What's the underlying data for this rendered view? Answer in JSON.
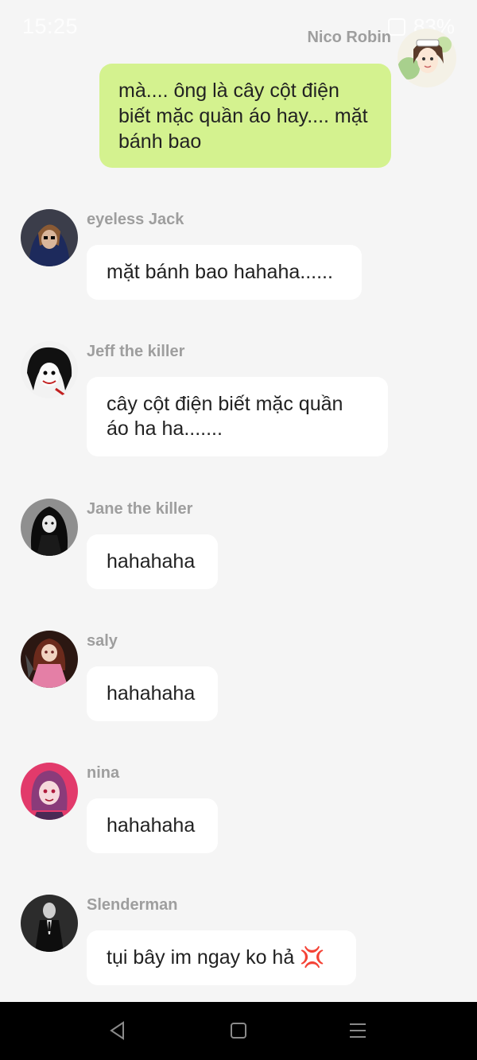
{
  "status_bar": {
    "time": "15:25",
    "battery": "83%"
  },
  "chat": {
    "self_message": {
      "sender": "Nico Robin",
      "avatar_icon": "anime-girl-avatar",
      "text": "mà.... ông là cây cột điện biết mặc quần áo hay.... mặt bánh bao",
      "color": "#d4f28f"
    },
    "messages": [
      {
        "sender": "eyeless Jack",
        "text": "mặt bánh bao hahaha......",
        "avatar_icon": "hooded-figure-avatar"
      },
      {
        "sender": "Jeff the killer",
        "text": "cây cột điện biết mặc quần áo ha ha.......",
        "avatar_icon": "pale-face-avatar"
      },
      {
        "sender": "Jane the killer",
        "text": "hahahaha",
        "avatar_icon": "dark-girl-avatar"
      },
      {
        "sender": "saly",
        "text": "hahahaha",
        "avatar_icon": "pink-dress-girl-avatar"
      },
      {
        "sender": "nina",
        "text": "hahahaha",
        "avatar_icon": "pink-hair-girl-avatar"
      },
      {
        "sender": "Slenderman",
        "text": "tụi bây im ngay ko hả 💢",
        "avatar_icon": "slenderman-avatar"
      }
    ]
  },
  "nav_bar": {
    "back_icon": "back-triangle-icon",
    "home_icon": "home-square-icon",
    "menu_icon": "recents-menu-icon"
  }
}
